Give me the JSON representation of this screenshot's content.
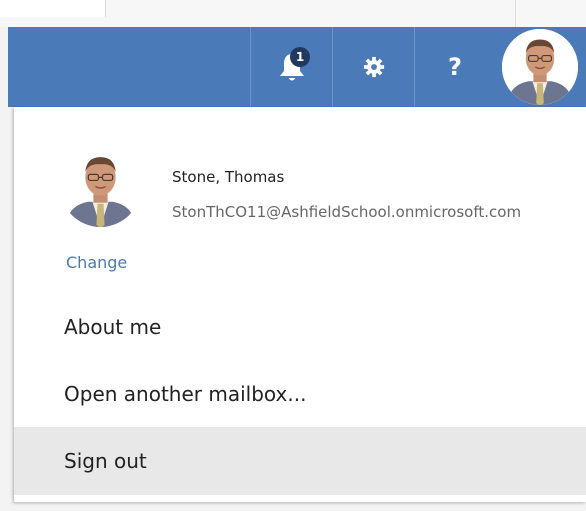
{
  "header": {
    "notifications": {
      "count": "1",
      "icon": "bell-icon"
    },
    "settings": {
      "icon": "gear-icon"
    },
    "help": {
      "icon": "help-icon",
      "glyph": "?"
    },
    "avatar": {
      "icon": "user-avatar"
    }
  },
  "profile": {
    "name": "Stone, Thomas",
    "email": "StonThCO11@AshfieldSchool.onmicrosoft.com",
    "change_label": "Change"
  },
  "menu": {
    "about_me": "About me",
    "open_mailbox": "Open another mailbox...",
    "sign_out": "Sign out"
  },
  "colors": {
    "nav_bar": "#4a7ab8",
    "badge": "#21395e",
    "link": "#4a7ab8",
    "hover_row": "#e8e8e8"
  }
}
